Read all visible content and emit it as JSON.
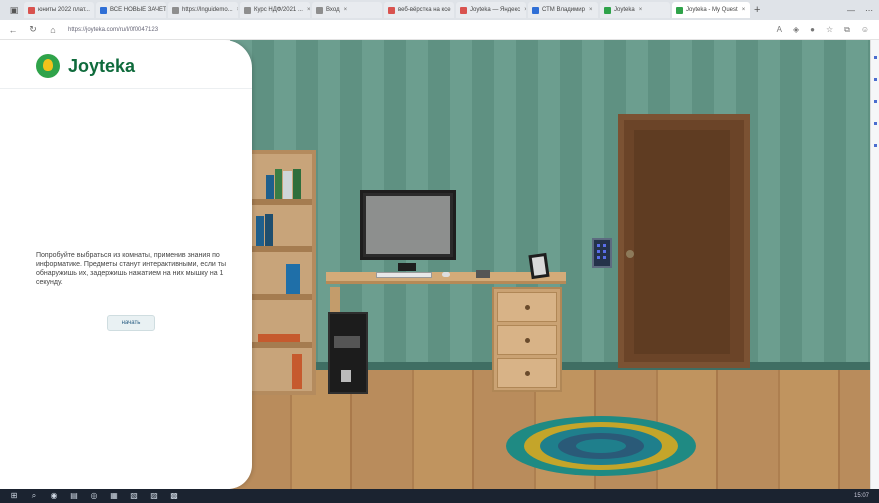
{
  "browser": {
    "tabs": [
      {
        "label": "юниты 2022 плат...",
        "color": "#d9534f"
      },
      {
        "label": "ВСЕ НОВЫЕ ЗАЧЕТ...",
        "color": "#2f6fd6"
      },
      {
        "label": "https://lnguidemo...",
        "color": "#8e8e8e"
      },
      {
        "label": "Курс НДФ/2021 ...",
        "color": "#8e8e8e"
      },
      {
        "label": "Вход",
        "color": "#8e8e8e"
      },
      {
        "label": "веб-вёрстка на ксе",
        "color": "#d9534f"
      },
      {
        "label": "Joyteka — Яндекс",
        "color": "#d9534f"
      },
      {
        "label": "СТМ Владимир",
        "color": "#2f6fd6"
      },
      {
        "label": "Joyteka",
        "color": "#2fa34a"
      },
      {
        "label": "Joyteka - My Quest",
        "color": "#2fa34a"
      }
    ],
    "active_tab_index": 9,
    "url": "https://joyteka.com/ru/l/0f0047123"
  },
  "panel": {
    "logo_text": "Joyteka",
    "intro_text": "Попробуйте выбраться из комнаты, применив знания по информатике. Предметы станут интерактивными, если ты обнаружишь их, задержишь нажатием на них мышку на 1 секунду.",
    "start_button": "начать"
  },
  "colors": {
    "brand_green": "#0f6b3c",
    "wall": "#6c9e8f",
    "door": "#6b4428"
  },
  "taskbar": {
    "clock": "15:07"
  }
}
